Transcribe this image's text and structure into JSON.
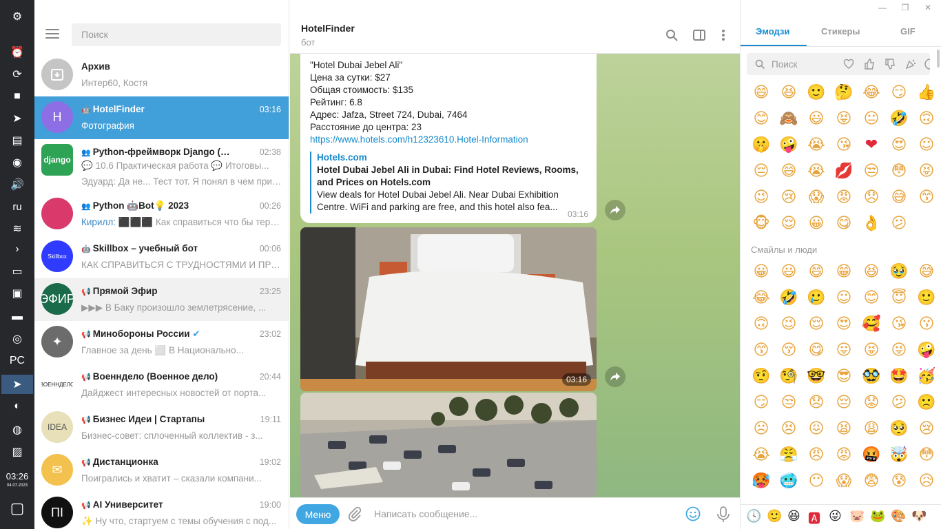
{
  "taskbar": {
    "apps": [
      {
        "name": "settings-icon",
        "glyph": "⚙"
      },
      {
        "name": "notifications-icon",
        "glyph": "⏰"
      },
      {
        "name": "updates-icon",
        "glyph": "⟳"
      },
      {
        "name": "cube-app-icon",
        "glyph": "■"
      },
      {
        "name": "send-app-icon",
        "glyph": "➤"
      },
      {
        "name": "clipboard-icon",
        "glyph": "▤"
      },
      {
        "name": "disk-icon",
        "glyph": "◉"
      },
      {
        "name": "volume-icon",
        "glyph": "🔊"
      },
      {
        "name": "keyboard-layout",
        "glyph": "ru"
      },
      {
        "name": "wifi-icon",
        "glyph": "≋"
      },
      {
        "name": "terminal-icon",
        "glyph": "›"
      },
      {
        "name": "window-icon",
        "glyph": "▭"
      },
      {
        "name": "store-icon",
        "glyph": "▣"
      },
      {
        "name": "files-icon",
        "glyph": "▬"
      },
      {
        "name": "firefox-icon",
        "glyph": "◎"
      },
      {
        "name": "pycharm-icon",
        "glyph": "PC"
      },
      {
        "name": "telegram-icon",
        "glyph": "➤"
      },
      {
        "name": "browser-icon",
        "glyph": "◐"
      },
      {
        "name": "tor-icon",
        "glyph": "◍"
      },
      {
        "name": "image-viewer-icon",
        "glyph": "▨"
      }
    ],
    "clock": "03:26",
    "date": "04.07.2023"
  },
  "sidebar": {
    "search_placeholder": "Поиск",
    "archive": {
      "name": "Архив",
      "preview": "Интер60, Костя"
    },
    "chats": [
      {
        "title": "HotelFinder",
        "time": "03:16",
        "preview": "Фотография",
        "avatar_letter": "H",
        "avatar_color": "#8e6ee4",
        "type": "bot",
        "selected": true
      },
      {
        "title": "Python-фреймворк Django (Skillb...",
        "time": "02:38",
        "preview": "💬 10.6 Практическая работа 💬 Итоговы...",
        "preview2": "Эдуард: Да не... Тест тот. Я понял в чем прич...",
        "avatar_letter": "django",
        "avatar_color": "#2ea356",
        "type": "group"
      },
      {
        "title": "Python 🤖Bot💡 2023",
        "time": "00:26",
        "sender": "Кирилл:",
        "preview": "⬛⬛⬛ Как справиться что бы терми...",
        "avatar_letter": "",
        "avatar_color": "#d93a6b",
        "type": "group"
      },
      {
        "title": "Skillbox – учебный бот",
        "time": "00:06",
        "preview": "КАК СПРАВИТЬСЯ С ТРУДНОСТЯМИ И ПРОЙ...",
        "avatar_letter": "Skillbox",
        "avatar_color": "#2f3bff",
        "type": "bot"
      },
      {
        "title": "Прямой Эфир",
        "time": "23:25",
        "preview": "▶▶▶ В Баку произошло землетрясение, ...",
        "avatar_letter": "ЭФИР",
        "avatar_color": "#1a6b4a",
        "type": "channel"
      },
      {
        "title": "Минобороны России",
        "time": "23:02",
        "preview": "Главное за день ⬜ В Национально...",
        "avatar_letter": "✦",
        "avatar_color": "#6c6c6c",
        "type": "channel",
        "verified": true
      },
      {
        "title": "Военндело (Военное дело)",
        "time": "20:44",
        "preview": "Дайджест интересных новостей от порта...",
        "avatar_letter": "ВОЕННДЕЛО",
        "avatar_color": "#ffffff",
        "type": "channel"
      },
      {
        "title": "Бизнес Идеи | Стартапы",
        "time": "19:11",
        "preview": "Бизнес-совет: сплоченный коллектив - з...",
        "avatar_letter": "IDEA",
        "avatar_color": "#e7e0b8",
        "type": "channel"
      },
      {
        "title": "Дистанционка",
        "time": "19:02",
        "preview": "Поигрались и хватит – сказали компани...",
        "avatar_letter": "✉",
        "avatar_color": "#f2c14e",
        "type": "channel"
      },
      {
        "title": "AI Университет",
        "time": "19:00",
        "preview": "✨ Ну что, стартуем с темы обучения с под...",
        "avatar_letter": "ПI",
        "avatar_color": "#111111",
        "type": "channel"
      }
    ]
  },
  "chat": {
    "title": "HotelFinder",
    "subtitle": "бот",
    "message": {
      "lines": [
        "\"Hotel Dubai Jebel Ali\"",
        "Цена за сутки: $27",
        "Общая стоимость: $135",
        "Рейтинг: 6.8",
        "Адрес: Jafza, Street 724, Dubai, 7464",
        "Расстояние до центра: 23"
      ],
      "url": "https://www.hotels.com/h12323610.Hotel-Information",
      "preview_site": "Hotels.com",
      "preview_title": "Hotel Dubai Jebel Ali in Dubai: Find Hotel Reviews, Rooms, and Prices on Hotels.com",
      "preview_desc": "View deals for Hotel Dubai Jebel Ali. Near Dubai Exhibition Centre. WiFi and parking are free, and this hotel also fea...",
      "time": "03:16"
    },
    "photo_time": "03:16",
    "composer": {
      "menu_label": "Меню",
      "placeholder": "Написать сообщение..."
    }
  },
  "emoji_panel": {
    "tabs": [
      "Эмодзи",
      "Стикеры",
      "GIF"
    ],
    "search_placeholder": "Поиск",
    "recent": [
      "😄",
      "😆",
      "🙂",
      "🤔",
      "😂",
      "😏",
      "👍",
      "😊",
      "🙈",
      "😃",
      "😝",
      "😐",
      "🤣",
      "🙃",
      "🤫",
      "🤪",
      "😭",
      "😘",
      "❤",
      "😍",
      "☺",
      "😔",
      "😄",
      "😭",
      "💋",
      "😒",
      "😳",
      "😝",
      "😉",
      "😢",
      "😱",
      "😡",
      "😞",
      "😅",
      "😙",
      "🐵",
      "😌",
      "😀",
      "😋",
      "👌",
      "😕"
    ],
    "section_title": "Смайлы и люди",
    "people": [
      "😀",
      "😃",
      "😄",
      "😁",
      "😆",
      "🥹",
      "😅",
      "😂",
      "🤣",
      "🥲",
      "☺",
      "😊",
      "😇",
      "🙂",
      "🙃",
      "😉",
      "😌",
      "😍",
      "🥰",
      "😘",
      "😗",
      "😙",
      "😚",
      "😋",
      "😛",
      "😝",
      "😜",
      "🤪",
      "🤨",
      "🧐",
      "🤓",
      "😎",
      "🥸",
      "🤩",
      "🥳",
      "😏",
      "😒",
      "😞",
      "😔",
      "😟",
      "😕",
      "🙁",
      "☹",
      "😣",
      "😖",
      "😫",
      "😩",
      "🥺",
      "😢",
      "😭",
      "😤",
      "😠",
      "😡",
      "🤬",
      "🤯",
      "😳",
      "🥵",
      "🥶",
      "😶",
      "😱",
      "😨",
      "😰",
      "😥"
    ],
    "footer": [
      "🕓",
      "🙂",
      "😆",
      "🅰",
      "😜",
      "🐷",
      "🐸",
      "🎨",
      "🐶"
    ]
  },
  "window": {
    "minimize": "—",
    "maximize": "❐",
    "close": "✕"
  }
}
